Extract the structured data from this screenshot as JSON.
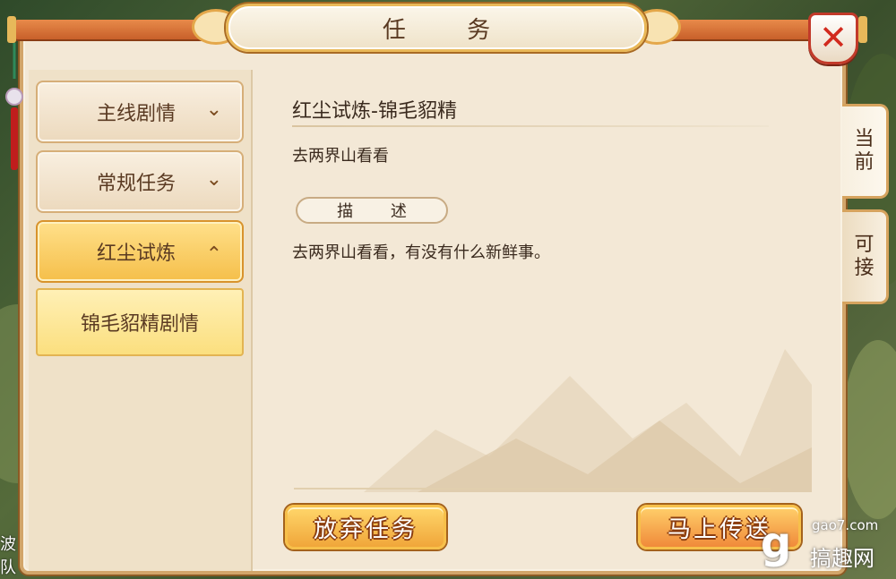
{
  "window": {
    "title": "任 务",
    "close_icon": "close-icon"
  },
  "sidebar": {
    "items": [
      {
        "label": "主线剧情",
        "icon": "chevron-down-icon",
        "chevron": "⌄"
      },
      {
        "label": "常规任务",
        "icon": "chevron-down-icon",
        "chevron": "⌄"
      },
      {
        "label": "红尘试炼",
        "icon": "chevron-up-icon",
        "chevron": "⌃",
        "active": true
      }
    ],
    "sub_item": {
      "label": "锦毛貂精剧情",
      "selected": true
    }
  },
  "quest": {
    "title": "红尘试炼-锦毛貂精",
    "goal": "去两界山看看",
    "description_tag": "描 述",
    "description": "去两界山看看，有没有什么新鲜事。"
  },
  "actions": {
    "abandon_label": "放弃任务",
    "teleport_label": "马上传送"
  },
  "tabs": [
    {
      "label": "当前"
    },
    {
      "label": "可接"
    }
  ],
  "edge_text": [
    "波",
    "队"
  ],
  "watermark": {
    "logo": "g",
    "domain": "gao7.com",
    "name": "搞趣网"
  },
  "colors": {
    "accent": "#f0a63a",
    "panel": "#f3e8d6",
    "close": "#d22a1e"
  }
}
